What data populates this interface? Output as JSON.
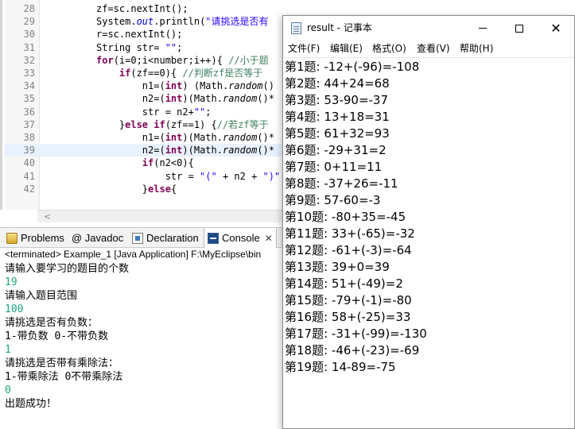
{
  "editor": {
    "lines": [
      {
        "num": "28",
        "segs": [
          {
            "t": "zf=sc.nextInt();",
            "c": ""
          }
        ]
      },
      {
        "num": "29",
        "segs": [
          {
            "t": "System.",
            "c": ""
          },
          {
            "t": "out",
            "c": "fld"
          },
          {
            "t": ".println(",
            "c": ""
          },
          {
            "t": "\"请挑选是否有",
            "c": "str"
          }
        ]
      },
      {
        "num": "30",
        "segs": [
          {
            "t": "r=sc.nextInt();",
            "c": ""
          }
        ]
      },
      {
        "num": "31",
        "segs": [
          {
            "t": "String str= ",
            "c": ""
          },
          {
            "t": "\"\"",
            "c": "str"
          },
          {
            "t": ";",
            "c": ""
          }
        ]
      },
      {
        "num": "32",
        "segs": [
          {
            "t": "for",
            "c": "kw"
          },
          {
            "t": "(i=0;i<number;i++){ ",
            "c": ""
          },
          {
            "t": "//小于题",
            "c": "com"
          }
        ]
      },
      {
        "num": "33",
        "segs": [
          {
            "t": "    ",
            "c": ""
          },
          {
            "t": "if",
            "c": "kw"
          },
          {
            "t": "(zf==0){ ",
            "c": ""
          },
          {
            "t": "//判断zf是否等于",
            "c": "com"
          }
        ]
      },
      {
        "num": "34",
        "segs": [
          {
            "t": "        n1=(",
            "c": ""
          },
          {
            "t": "int",
            "c": "kw"
          },
          {
            "t": ") (Math.",
            "c": ""
          },
          {
            "t": "random",
            "c": "mth"
          },
          {
            "t": "()",
            "c": ""
          }
        ]
      },
      {
        "num": "35",
        "segs": [
          {
            "t": "        n2=(",
            "c": ""
          },
          {
            "t": "int",
            "c": "kw"
          },
          {
            "t": ")(Math.",
            "c": ""
          },
          {
            "t": "random",
            "c": "mth"
          },
          {
            "t": "()*",
            "c": ""
          }
        ]
      },
      {
        "num": "36",
        "segs": [
          {
            "t": "        str = n2+",
            "c": ""
          },
          {
            "t": "\"\"",
            "c": "str"
          },
          {
            "t": ";",
            "c": ""
          }
        ]
      },
      {
        "num": "37",
        "segs": [
          {
            "t": "    }",
            "c": ""
          },
          {
            "t": "else if",
            "c": "kw"
          },
          {
            "t": "(zf==1) {",
            "c": ""
          },
          {
            "t": "//若zf等于",
            "c": "com"
          }
        ]
      },
      {
        "num": "38",
        "segs": [
          {
            "t": "        n1=(",
            "c": ""
          },
          {
            "t": "int",
            "c": "kw"
          },
          {
            "t": ")(Math.",
            "c": ""
          },
          {
            "t": "random",
            "c": "mth"
          },
          {
            "t": "()*",
            "c": ""
          }
        ]
      },
      {
        "num": "39",
        "segs": [
          {
            "t": "        n2=(",
            "c": ""
          },
          {
            "t": "int",
            "c": "kw"
          },
          {
            "t": ")(Math.",
            "c": ""
          },
          {
            "t": "random",
            "c": "mth"
          },
          {
            "t": "()*",
            "c": ""
          }
        ]
      },
      {
        "num": "40",
        "segs": [
          {
            "t": "        ",
            "c": ""
          },
          {
            "t": "if",
            "c": "kw"
          },
          {
            "t": "(n2<0){",
            "c": ""
          }
        ]
      },
      {
        "num": "41",
        "segs": [
          {
            "t": "            str = ",
            "c": ""
          },
          {
            "t": "\"(\"",
            "c": "str"
          },
          {
            "t": " + n2 + ",
            "c": ""
          },
          {
            "t": "\")\"",
            "c": "str"
          }
        ]
      },
      {
        "num": "42",
        "segs": [
          {
            "t": "        }",
            "c": ""
          },
          {
            "t": "else",
            "c": "kw"
          },
          {
            "t": "{",
            "c": ""
          }
        ]
      }
    ]
  },
  "views": {
    "tabs": [
      {
        "label": "Problems",
        "icon": "problems-icon"
      },
      {
        "label": "@ Javadoc",
        "icon": "javadoc-icon"
      },
      {
        "label": "Declaration",
        "icon": "declaration-icon"
      },
      {
        "label": "Console",
        "icon": "console-icon",
        "active": true
      }
    ],
    "console_close": "✕"
  },
  "console": {
    "status": "<terminated> Example_1 [Java Application] F:\\MyEclipse\\bin",
    "lines": [
      {
        "text": "请输入要学习的题目的个数",
        "kind": "out"
      },
      {
        "text": "19",
        "kind": "in"
      },
      {
        "text": "请输入题目范围",
        "kind": "out"
      },
      {
        "text": "100",
        "kind": "in"
      },
      {
        "text": "请挑选是否有负数：",
        "kind": "out"
      },
      {
        "text": "1-带负数 0-不带负数",
        "kind": "out"
      },
      {
        "text": "1",
        "kind": "in"
      },
      {
        "text": "请挑选是否带有乘除法：",
        "kind": "out"
      },
      {
        "text": "1-带乘除法 0不带乘除法",
        "kind": "out"
      },
      {
        "text": "0",
        "kind": "in"
      },
      {
        "text": "出题成功！",
        "kind": "out"
      }
    ]
  },
  "notepad": {
    "title": "result - 记事本",
    "menu": [
      "文件(F)",
      "编辑(E)",
      "格式(O)",
      "查看(V)",
      "帮助(H)"
    ],
    "lines": [
      "第1题: -12+(-96)=-108",
      "第2题: 44+24=68",
      "第3题: 53-90=-37",
      "第4题: 13+18=31",
      "第5题: 61+32=93",
      "第6题: -29+31=2",
      "第7题: 0+11=11",
      "第8题: -37+26=-11",
      "第9题: 57-60=-3",
      "第10题: -80+35=-45",
      "第11题: 33+(-65)=-32",
      "第12题: -61+(-3)=-64",
      "第13题: 39+0=39",
      "第14题: 51+(-49)=2",
      "第15题: -79+(-1)=-80",
      "第16题: 58+(-25)=33",
      "第17题: -31+(-99)=-130",
      "第18题: -46+(-23)=-69",
      "第19题: 14-89=-75"
    ]
  }
}
